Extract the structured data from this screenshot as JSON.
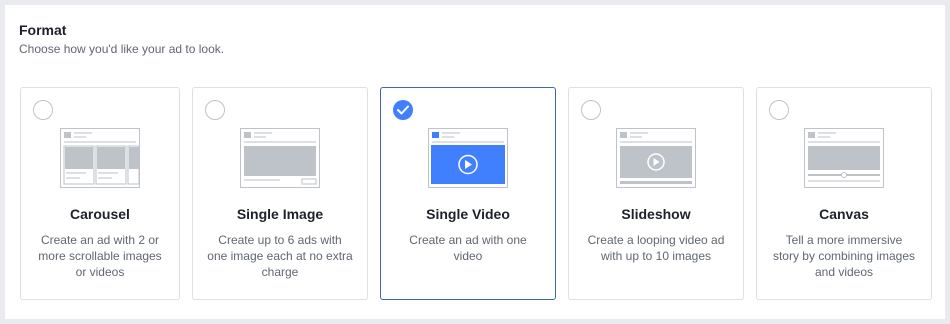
{
  "format": {
    "title": "Format",
    "subtitle": "Choose how you'd like your ad to look."
  },
  "options": [
    {
      "label": "Carousel",
      "description": "Create an ad with 2 or more scrollable images or videos",
      "selected": false
    },
    {
      "label": "Single Image",
      "description": "Create up to 6 ads with one image each at no extra charge",
      "selected": false
    },
    {
      "label": "Single Video",
      "description": "Create an ad with one video",
      "selected": true
    },
    {
      "label": "Slideshow",
      "description": "Create a looping video ad with up to 10 images",
      "selected": false
    },
    {
      "label": "Canvas",
      "description": "Tell a more immersive story by combining images and videos",
      "selected": false
    }
  ],
  "colors": {
    "accent": "#4080ff",
    "selected_border": "#4267b2",
    "card_border": "#dddfe2",
    "text_primary": "#1d2129",
    "text_secondary": "#606770",
    "background": "#e9ebee"
  },
  "icons": {
    "checkmark": "checkmark-icon",
    "play": "play-icon"
  }
}
